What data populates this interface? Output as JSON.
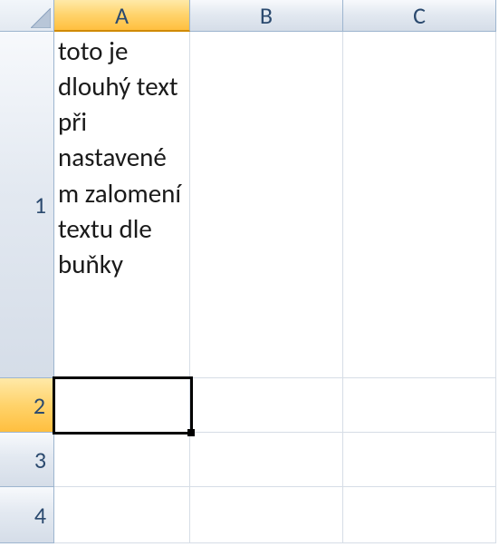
{
  "columns": {
    "A": "A",
    "B": "B",
    "C": "C"
  },
  "rows": {
    "r1": "1",
    "r2": "2",
    "r3": "3",
    "r4": "4"
  },
  "cells": {
    "A1": "toto je dlouhý text při nastaveném zalomení textu dle buňky",
    "A2": "",
    "A3": "",
    "A4": "",
    "B1": "",
    "B2": "",
    "B3": "",
    "B4": "",
    "C1": "",
    "C2": "",
    "C3": "",
    "C4": ""
  },
  "active_cell": "A2",
  "chart_data": {
    "type": "table",
    "columns": [
      "A",
      "B",
      "C"
    ],
    "rows": [
      [
        "toto je dlouhý text při nastaveném zalomení textu dle buňky",
        "",
        ""
      ],
      [
        "",
        "",
        ""
      ],
      [
        "",
        "",
        ""
      ],
      [
        "",
        "",
        ""
      ]
    ]
  }
}
